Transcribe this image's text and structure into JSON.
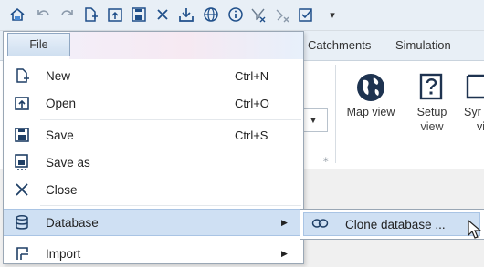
{
  "quick_access": {
    "icons": [
      "home-icon",
      "undo-icon",
      "redo-icon",
      "new-file-icon",
      "open-icon",
      "save-icon",
      "close-icon",
      "download-icon",
      "globe-icon",
      "info-icon",
      "filter-clear-icon",
      "filter-remove-icon",
      "checkbox-icon",
      "customize-dropdown-icon"
    ]
  },
  "ribbon": {
    "tabs": [
      "Catchments",
      "Simulation"
    ],
    "buttons": {
      "map_view": "Map view",
      "setup_view_line1": "Setup",
      "setup_view_line2": "view",
      "sym_line1": "Syr",
      "sym_line2": "vi"
    }
  },
  "file_menu": {
    "tab_label": "File",
    "items": [
      {
        "label": "New",
        "shortcut": "Ctrl+N",
        "icon": "new-file-icon"
      },
      {
        "label": "Open",
        "shortcut": "Ctrl+O",
        "icon": "open-icon"
      },
      {
        "label": "Save",
        "shortcut": "Ctrl+S",
        "icon": "save-icon"
      },
      {
        "label": "Save as",
        "shortcut": "",
        "icon": "save-as-icon"
      },
      {
        "label": "Close",
        "shortcut": "",
        "icon": "close-icon"
      },
      {
        "label": "Database",
        "shortcut": "",
        "icon": "database-icon",
        "highlighted": true,
        "submenu": true
      },
      {
        "label": "Import",
        "shortcut": "",
        "icon": "import-icon",
        "submenu": true
      }
    ]
  },
  "submenu": {
    "items": [
      {
        "label": "Clone database ...",
        "icon": "clone-icon",
        "highlighted": true
      }
    ]
  },
  "colors": {
    "highlight": "#cfe0f3",
    "highlight_border": "#a9c4e4",
    "icon_blue": "#1f4f8a"
  }
}
